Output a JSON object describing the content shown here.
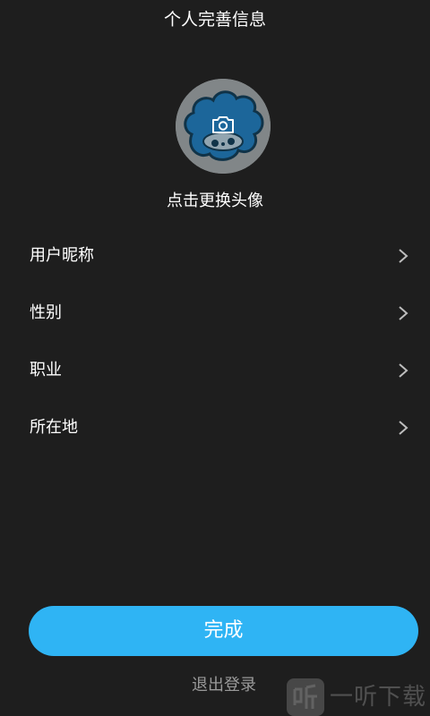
{
  "header": {
    "title": "个人完善信息"
  },
  "avatar": {
    "caption": "点击更换头像"
  },
  "rows": [
    {
      "label": "用户昵称"
    },
    {
      "label": "性别"
    },
    {
      "label": "职业"
    },
    {
      "label": "所在地"
    }
  ],
  "actions": {
    "done_label": "完成",
    "logout_label": "退出登录"
  },
  "watermark": {
    "text": "一听下载"
  },
  "colors": {
    "background": "#1e1e1e",
    "accent": "#2fb4f4",
    "secondary_text": "#9a9a9a"
  }
}
